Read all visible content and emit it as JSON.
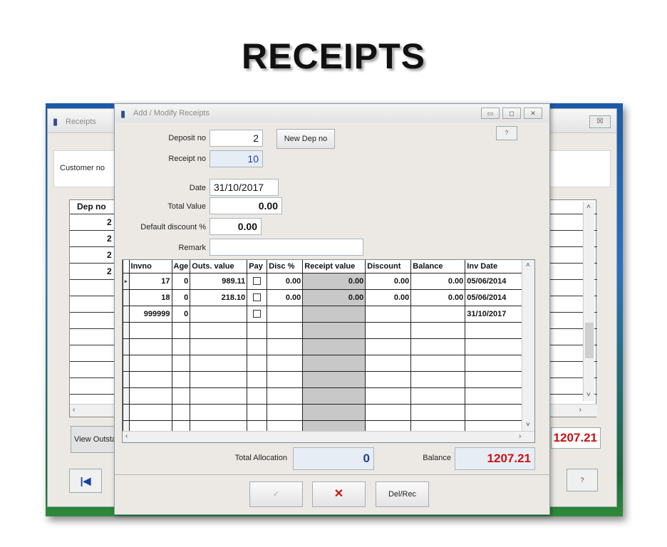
{
  "slide": {
    "title": "RECEIPTS"
  },
  "back_window": {
    "title": "Receipts",
    "close_glyph": "☒",
    "customer_label": "Customer no",
    "grid_header": "Dep no",
    "rows": [
      "2",
      "2",
      "2",
      "2"
    ],
    "view_button": "View Outsta",
    "balance": "1207.21",
    "first_glyph": "|◀",
    "help_glyph": "?"
  },
  "dialog": {
    "title": "Add / Modify Receipts",
    "help_glyph": "?",
    "deposit_label": "Deposit no",
    "deposit_value": "2",
    "new_dep_button": "New Dep no",
    "receipt_label": "Receipt no",
    "receipt_value": "10",
    "date_label": "Date",
    "date_value": "31/10/2017",
    "total_value_label": "Total Value",
    "total_value": "0.00",
    "discount_label": "Default discount %",
    "discount_value": "0.00",
    "remark_label": "Remark",
    "remark_value": "",
    "grid": {
      "columns": [
        "Invno",
        "Age",
        "Outs. value",
        "Pay",
        "Disc %",
        "Receipt value",
        "Discount",
        "Balance",
        "Inv Date"
      ],
      "rows": [
        {
          "sel": "▸",
          "invno": "17",
          "age": "0",
          "outs": "989.11",
          "disc": "0.00",
          "receipt": "0.00",
          "discount": "0.00",
          "balance": "0.00",
          "date": "05/06/2014"
        },
        {
          "sel": "",
          "invno": "18",
          "age": "0",
          "outs": "218.10",
          "disc": "0.00",
          "receipt": "0.00",
          "discount": "0.00",
          "balance": "0.00",
          "date": "05/06/2014"
        },
        {
          "sel": "",
          "invno": "999999",
          "age": "0",
          "outs": "",
          "disc": "",
          "receipt": "",
          "discount": "",
          "balance": "",
          "date": "31/10/2017"
        }
      ],
      "empty_rows": 7
    },
    "total_allocation_label": "Total Allocation",
    "total_allocation": "0",
    "balance_label": "Balance",
    "balance": "1207.21",
    "ok_glyph": "✓",
    "cancel_glyph": "✕",
    "delrec_label": "Del/Rec"
  },
  "colors": {
    "balance": "#cc1010",
    "blue_value": "#1a3fa0"
  }
}
